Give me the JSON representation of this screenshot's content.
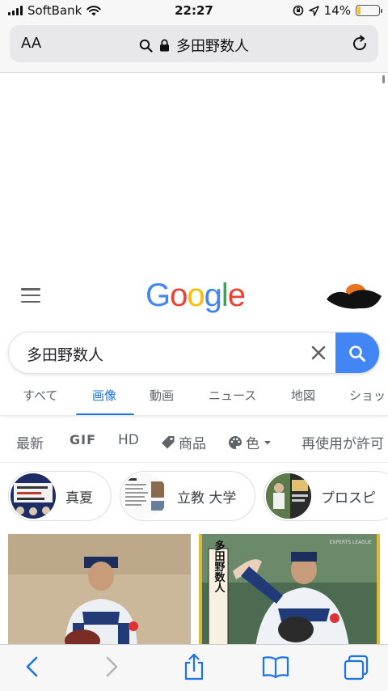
{
  "status": {
    "carrier": "SoftBank",
    "time": "22:27",
    "battery_pct": "14%",
    "battery_level": 0.14,
    "battery_color": "#f2c230"
  },
  "url_bar": {
    "text_size_label": "AA",
    "address": "多田野数人",
    "icons": [
      "search-icon",
      "lock-icon",
      "reload-icon"
    ]
  },
  "google": {
    "logo_letters": [
      "G",
      "o",
      "o",
      "g",
      "l",
      "e"
    ],
    "logo_colors": [
      "#4285f4",
      "#ea4335",
      "#fbbc05",
      "#4285f4",
      "#34a853",
      "#ea4335"
    ]
  },
  "search": {
    "query": "多田野数人",
    "button_color": "#4285f4"
  },
  "tabs": [
    {
      "label": "すべて",
      "active": false
    },
    {
      "label": "画像",
      "active": true
    },
    {
      "label": "動画",
      "active": false
    },
    {
      "label": "ニュース",
      "active": false
    },
    {
      "label": "地図",
      "active": false
    },
    {
      "label": "ショッ",
      "active": false
    }
  ],
  "filters": [
    {
      "label": "最新"
    },
    {
      "label": "GIF"
    },
    {
      "label": "HD"
    },
    {
      "label": "商品",
      "icon": "tag-icon"
    },
    {
      "label": "色",
      "icon": "palette-icon"
    },
    {
      "label": "再使用が許可"
    }
  ],
  "chips": [
    {
      "label": "真夏"
    },
    {
      "label": "立教 大学"
    },
    {
      "label": "プロスピ"
    }
  ],
  "results": {
    "right_image_caption": "多田野数人",
    "right_image_logo": "EXPERTS LEAGUE"
  },
  "toolbar": {
    "icons": [
      "back-icon",
      "forward-icon",
      "share-icon",
      "bookmarks-icon",
      "tabs-icon"
    ]
  }
}
